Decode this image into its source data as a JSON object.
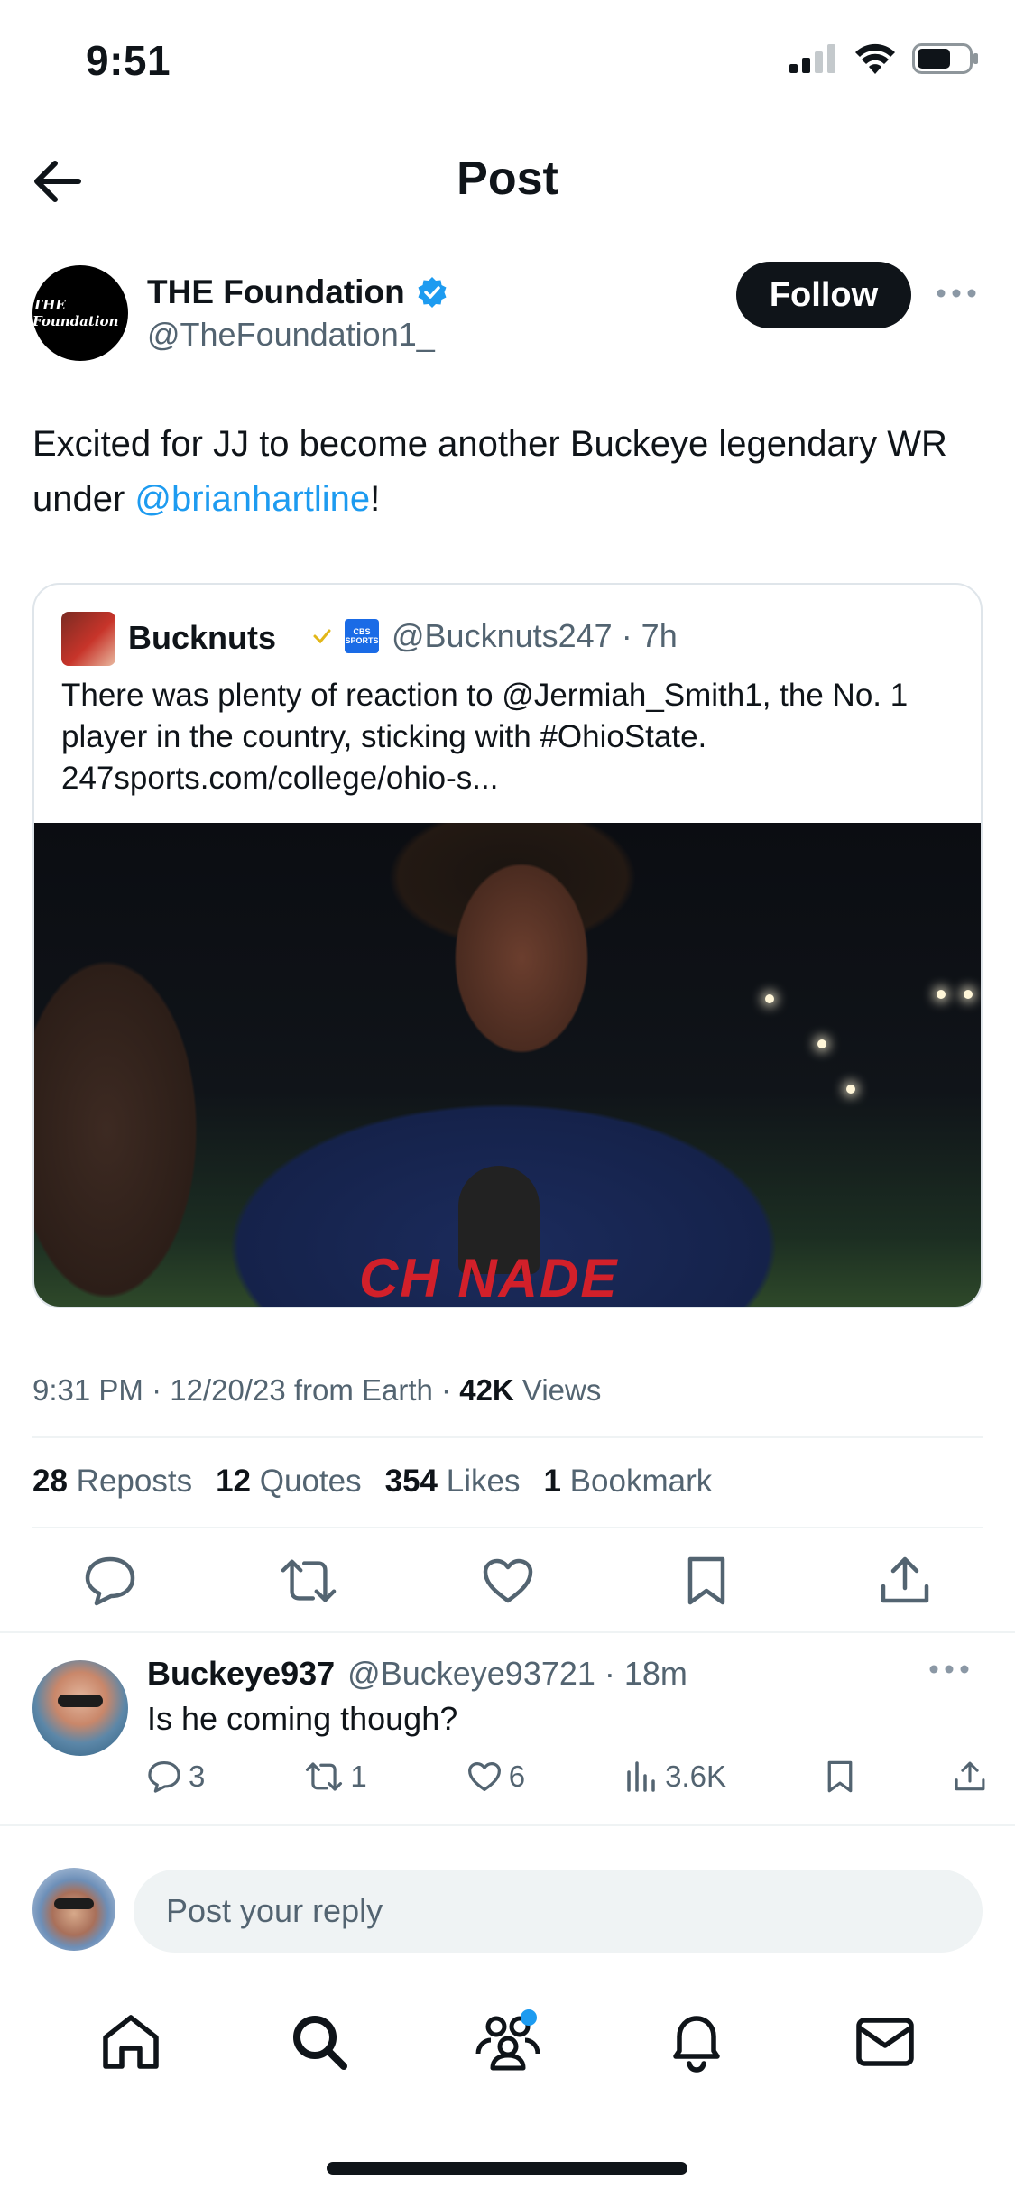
{
  "status_bar": {
    "time": "9:51"
  },
  "header": {
    "title": "Post"
  },
  "post": {
    "author_name": "THE Foundation",
    "author_handle": "@TheFoundation1_",
    "avatar_text": "THE Foundation",
    "follow_label": "Follow",
    "text_before": "Excited for JJ to become another Buckeye legendary WR under ",
    "mention": "@brianhartline",
    "text_after": "!",
    "timestamp": "9:31 PM · 12/20/23 from Earth · ",
    "views_count": "42K",
    "views_label": " Views"
  },
  "quote": {
    "name": "Bucknuts",
    "handle_time": "@Bucknuts247 · 7h",
    "cbs_logo": "CBS SPORTS",
    "text": "There was plenty of reaction to @Jermiah_Smith1, the No. 1 player in the country, sticking with #OhioState. 247sports.com/college/ohio-s...",
    "image_text": "CH  NADE"
  },
  "stats": {
    "reposts_count": "28",
    "reposts_label": "Reposts",
    "quotes_count": "12",
    "quotes_label": "Quotes",
    "likes_count": "354",
    "likes_label": "Likes",
    "bookmarks_count": "1",
    "bookmarks_label": "Bookmark"
  },
  "reply": {
    "name": "Buckeye937",
    "handle_time": "@Buckeye93721 · 18m",
    "text": "Is he coming though?",
    "replies": "3",
    "reposts": "1",
    "likes": "6",
    "views": "3.6K"
  },
  "composer": {
    "placeholder": "Post your reply"
  },
  "nav": {
    "items": [
      "home-icon",
      "search-icon",
      "communities-icon",
      "notifications-icon",
      "messages-icon"
    ]
  },
  "colors": {
    "accent": "#1d9bf0",
    "text": "#0f1419",
    "secondary": "#536471",
    "divider": "#eff3f4"
  }
}
